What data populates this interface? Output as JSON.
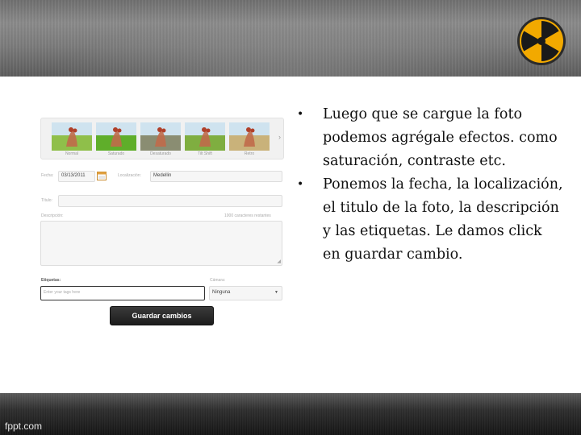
{
  "footer": {
    "credit": "fppt.com"
  },
  "editor": {
    "filters": [
      {
        "label": "Normal",
        "tone": "#8fbf4a"
      },
      {
        "label": "Saturado",
        "tone": "#5fae2a"
      },
      {
        "label": "Desaturado",
        "tone": "#8a8d72"
      },
      {
        "label": "Tilt Shift",
        "tone": "#7fae40"
      },
      {
        "label": "Retro",
        "tone": "#c9b27a"
      }
    ],
    "date_label": "Fecha:",
    "date_value": "03/13/2011",
    "location_label": "Localización:",
    "location_value": "Medellin",
    "title_label": "Título:",
    "title_value": "",
    "description_label": "Descripción:",
    "char_counter": "1000 caracteres restantes",
    "tags_label": "Etiquetas:",
    "tags_placeholder": "Enter your tags here",
    "camera_label": "Cámara:",
    "camera_value": "Ninguna",
    "save_label": "Guardar cambios"
  },
  "bullets": [
    "Luego que se cargue la foto podemos agrégale efectos. como saturación, contraste etc.",
    "Ponemos la fecha, la localización, el titulo de la foto, la descripción  y las etiquetas. Le damos click en guardar cambio."
  ],
  "colors": {
    "top_bar": "#7b7b7b",
    "bottom_bar": "#1e1e1e",
    "logo_yellow": "#f2a900"
  }
}
